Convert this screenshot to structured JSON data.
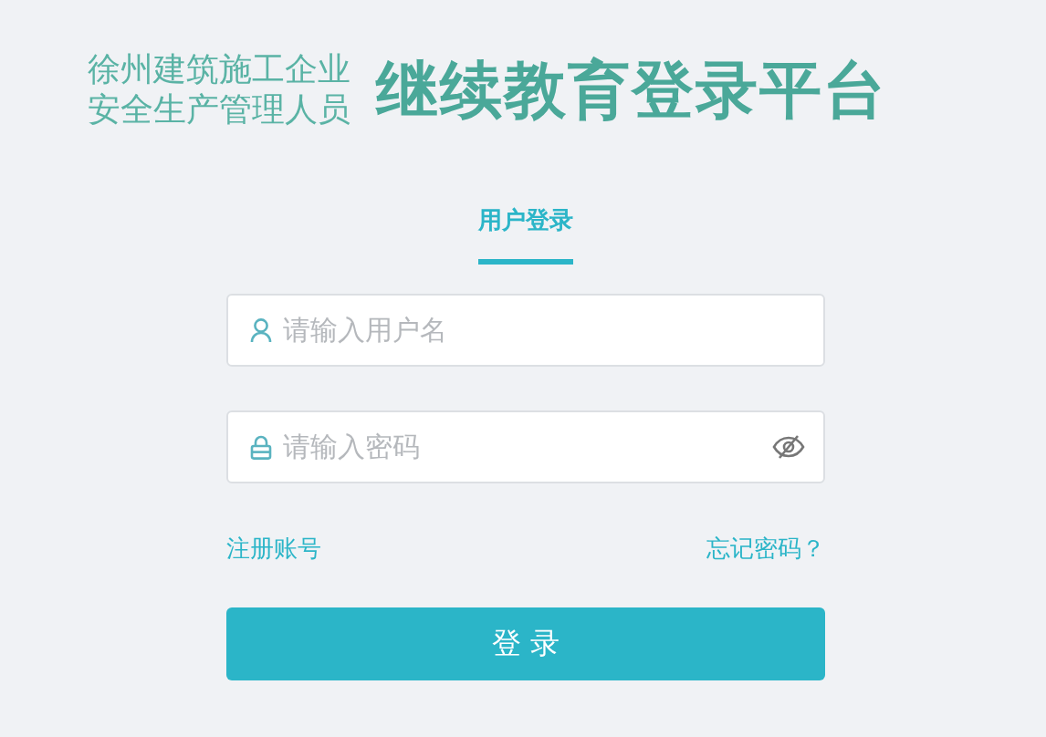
{
  "header": {
    "subtitle_lines": [
      "徐州建筑施工企业",
      "安全生产管理人员"
    ],
    "title": "继续教育登录平台"
  },
  "tabs": [
    {
      "label": "用户登录",
      "selected": true
    }
  ],
  "fields": [
    {
      "kind": "user",
      "placeholder": "请输入用户名"
    },
    {
      "kind": "password",
      "placeholder": "请输入密码"
    }
  ],
  "links": [
    "注册账号",
    "忘记密码？"
  ],
  "submit": "登 录"
}
